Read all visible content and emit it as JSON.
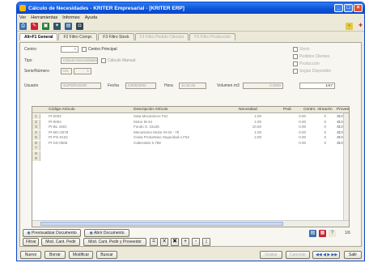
{
  "window": {
    "title": "Cálculo de Necesidades - KRITER Empresarial - [KRITER ERP]"
  },
  "menu": [
    "Ver",
    "Herramientas",
    "Informes",
    "Ayuda"
  ],
  "tabs": [
    {
      "label": "Alt+F1 General"
    },
    {
      "label": "F2 Filtro Compr."
    },
    {
      "label": "F3 Filtro Stock"
    },
    {
      "label": "F3 Filtro Pedido Clientes"
    },
    {
      "label": "F5 Filtro Producción"
    }
  ],
  "form": {
    "centro_label": "Centro",
    "centro_value": "0",
    "centro_principal": "Centro Principal",
    "tipo_label": "Tipo",
    "tipo_value": "Cálculo Necesidades",
    "calculo_manual": "Cálculo Manual",
    "serie_label": "Serie/Número",
    "serie_value": "CN",
    "numero_value": "1",
    "usuario_label": "Usuario",
    "usuario_value": "SUPERVISOR",
    "fecha_label": "Fecha",
    "fecha_value": "04/05/2002",
    "hora_label": "Hora",
    "hora_value": "11:45:46",
    "volumen_label": "Volumen m3",
    "volumen_value": "0.0000",
    "record_position": "1/47"
  },
  "options": [
    "Stock",
    "Pedidos Clientes",
    "Producción",
    "Según Disponible"
  ],
  "grid": {
    "headers": [
      "Código Artículo",
      "Descripción Artículo",
      "Necesidad",
      "Pedi",
      "Centro",
      "Almacén",
      "Provee"
    ],
    "rows": [
      [
        "PI-0002",
        "Sata Mecanismo F6J",
        "1.00",
        "0.00",
        "0",
        "0",
        "4100401"
      ],
      [
        "PI-0054",
        "Motor M-34",
        "1.00",
        "0.00",
        "0",
        "0",
        "4100401"
      ],
      [
        "PI-BL-1501",
        "Fundo S. 15x25",
        "10.50",
        "0.00",
        "0",
        "0",
        "4100401"
      ],
      [
        "PI-MC-0078",
        "Mecanismo Motor M-34 - 78",
        "1.00",
        "0.00",
        "0",
        "0",
        "4100401"
      ],
      [
        "PI-PG-0102",
        "Caisa Protuetaso Seguridad n.F52",
        "2.00",
        "0.00",
        "0",
        "0",
        "4100401"
      ],
      [
        "PI-SS-0566",
        "Cabecales 5.768",
        "",
        "0.00",
        "0",
        "0",
        "4100401"
      ]
    ]
  },
  "actions": {
    "previsualizar": "Previsualizar Documento",
    "abrir": "Abrir Documento",
    "filtrar": "Filtrar",
    "mod_cant_pedi": "Mod. Cant. Pedir",
    "mod_cant_prov": "Mod. Cant. Pedir y Proveedor",
    "page_info": "1/6"
  },
  "bottom": {
    "nuevo": "Nuevo",
    "borrar": "Borrar",
    "modificar": "Modificar",
    "buscar": "Buscar",
    "grabar": "Grabar",
    "cancelar": "Cancelar",
    "salir": "Salir"
  }
}
